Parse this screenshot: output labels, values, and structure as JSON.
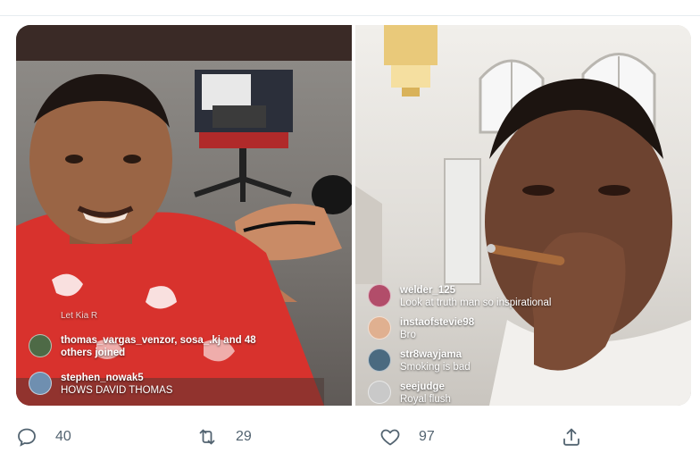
{
  "media": {
    "left": {
      "comments": [
        {
          "user": "Let Kia R",
          "message": ""
        },
        {
          "user": "thomas_vargas_venzor, sosa_.kj and 48",
          "message": "others joined"
        },
        {
          "user": "stephen_nowak5",
          "message": "HOWS DAVID THOMAS"
        }
      ]
    },
    "right": {
      "comments": [
        {
          "user": "welder_125",
          "message": "Look at truth man so inspirational"
        },
        {
          "user": "instaofstevie98",
          "message": "Bro"
        },
        {
          "user": "str8wayjama",
          "message": "Smoking is bad"
        },
        {
          "user": "seejudge",
          "message": "Royal flush"
        }
      ]
    }
  },
  "actions": {
    "reply": {
      "icon": "reply-icon",
      "count": "40"
    },
    "retweet": {
      "icon": "retweet-icon",
      "count": "29"
    },
    "like": {
      "icon": "heart-icon",
      "count": "97"
    },
    "share": {
      "icon": "share-icon"
    }
  },
  "colors": {
    "icon_gray": "#536471",
    "shirt_red": "#d8322d"
  }
}
